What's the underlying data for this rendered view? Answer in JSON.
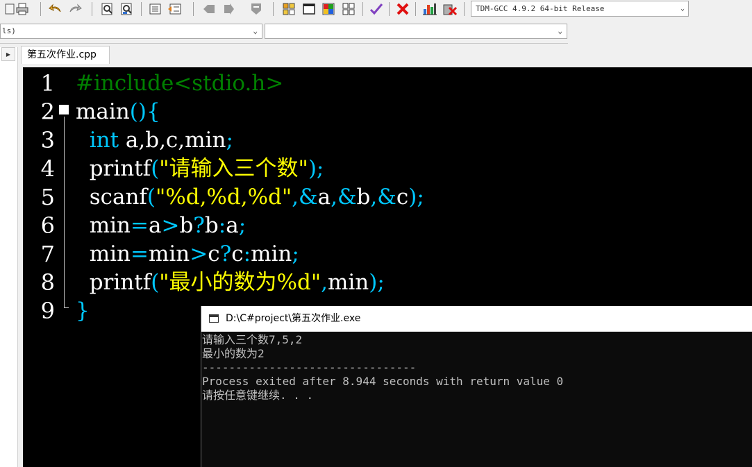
{
  "toolbar": {
    "compiler": "TDM-GCC 4.9.2 64-bit Release",
    "icons": [
      "print-icon",
      "undo-icon",
      "redo-icon",
      "find-icon",
      "replace-icon",
      "indent-icon",
      "unindent-icon",
      "bookmark-icon",
      "goto-icon",
      "stop-icon",
      "grid-icon",
      "window-icon",
      "palette-icon",
      "layout-icon",
      "check-icon",
      "close-icon",
      "chart-icon",
      "debug-icon"
    ]
  },
  "row2": {
    "combo1": "ls)",
    "combo2": ""
  },
  "tab": {
    "label": "第五次作业.cpp"
  },
  "editor": {
    "line_numbers": [
      "1",
      "2",
      "3",
      "4",
      "5",
      "6",
      "7",
      "8",
      "9"
    ],
    "lines": [
      [
        {
          "t": "#include<stdio.h>",
          "c": "pp"
        }
      ],
      [
        {
          "t": "main",
          "c": "tx"
        },
        {
          "t": "(){",
          "c": "op"
        }
      ],
      [
        {
          "t": "  int",
          "c": "kw"
        },
        {
          "t": " a,b,c,min",
          "c": "tx"
        },
        {
          "t": ";",
          "c": "op"
        }
      ],
      [
        {
          "t": "  printf",
          "c": "tx"
        },
        {
          "t": "(",
          "c": "op"
        },
        {
          "t": "\"请输入三个数\"",
          "c": "str"
        },
        {
          "t": ");",
          "c": "op"
        }
      ],
      [
        {
          "t": "  scanf",
          "c": "tx"
        },
        {
          "t": "(",
          "c": "op"
        },
        {
          "t": "\"%d,%d,%d\"",
          "c": "str"
        },
        {
          "t": ",&",
          "c": "op"
        },
        {
          "t": "a",
          "c": "tx"
        },
        {
          "t": ",&",
          "c": "op"
        },
        {
          "t": "b",
          "c": "tx"
        },
        {
          "t": ",&",
          "c": "op"
        },
        {
          "t": "c",
          "c": "tx"
        },
        {
          "t": ");",
          "c": "op"
        }
      ],
      [
        {
          "t": "  min",
          "c": "tx"
        },
        {
          "t": "=",
          "c": "op"
        },
        {
          "t": "a",
          "c": "tx"
        },
        {
          "t": ">",
          "c": "op"
        },
        {
          "t": "b",
          "c": "tx"
        },
        {
          "t": "?",
          "c": "op"
        },
        {
          "t": "b",
          "c": "tx"
        },
        {
          "t": ":",
          "c": "op"
        },
        {
          "t": "a",
          "c": "tx"
        },
        {
          "t": ";",
          "c": "op"
        }
      ],
      [
        {
          "t": "  min",
          "c": "tx"
        },
        {
          "t": "=",
          "c": "op"
        },
        {
          "t": "min",
          "c": "tx"
        },
        {
          "t": ">",
          "c": "op"
        },
        {
          "t": "c",
          "c": "tx"
        },
        {
          "t": "?",
          "c": "op"
        },
        {
          "t": "c",
          "c": "tx"
        },
        {
          "t": ":",
          "c": "op"
        },
        {
          "t": "min",
          "c": "tx"
        },
        {
          "t": ";",
          "c": "op"
        }
      ],
      [
        {
          "t": "  printf",
          "c": "tx"
        },
        {
          "t": "(",
          "c": "op"
        },
        {
          "t": "\"最小的数为%d\"",
          "c": "str"
        },
        {
          "t": ",",
          "c": "op"
        },
        {
          "t": "min",
          "c": "tx"
        },
        {
          "t": ");",
          "c": "op"
        }
      ],
      [
        {
          "t": "}",
          "c": "op"
        }
      ]
    ]
  },
  "console": {
    "title": "D:\\C#project\\第五次作业.exe",
    "lines": [
      "请输入三个数7,5,2",
      "最小的数为2",
      "--------------------------------",
      "Process exited after 8.944 seconds with return value 0",
      "请按任意键继续. . ."
    ]
  }
}
